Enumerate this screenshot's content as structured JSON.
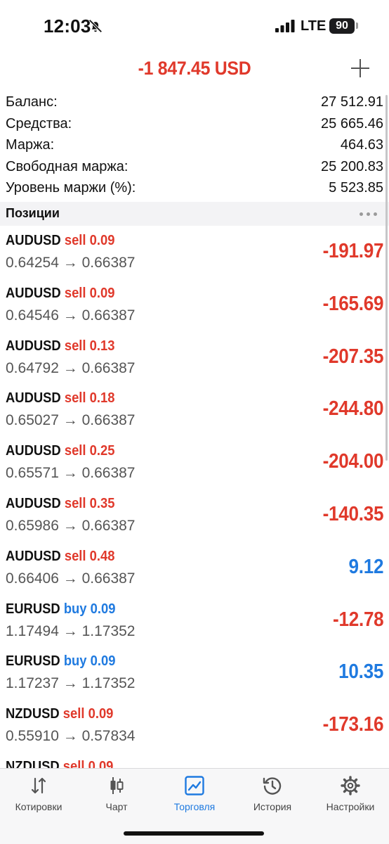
{
  "status_bar": {
    "time": "12:03",
    "network": "LTE",
    "battery": "90",
    "icons": [
      "bell-off-icon",
      "signal-icon",
      "battery-icon"
    ]
  },
  "header": {
    "total": "-1 847.45 USD",
    "add_icon": "plus-icon"
  },
  "summary": [
    {
      "label": "Баланс:",
      "value": "27 512.91"
    },
    {
      "label": "Средства:",
      "value": "25 665.46"
    },
    {
      "label": "Маржа:",
      "value": "464.63"
    },
    {
      "label": "Свободная маржа:",
      "value": "25 200.83"
    },
    {
      "label": "Уровень маржи (%):",
      "value": "5 523.85"
    }
  ],
  "section": {
    "title": "Позиции",
    "more_icon": "more-dots-icon"
  },
  "positions": [
    {
      "symbol": "AUDUSD",
      "type": "sell",
      "volume": "0.09",
      "prices": "0.64254 → 0.66387",
      "profit": "-191.97"
    },
    {
      "symbol": "AUDUSD",
      "type": "sell",
      "volume": "0.09",
      "prices": "0.64546 → 0.66387",
      "profit": "-165.69"
    },
    {
      "symbol": "AUDUSD",
      "type": "sell",
      "volume": "0.13",
      "prices": "0.64792 → 0.66387",
      "profit": "-207.35"
    },
    {
      "symbol": "AUDUSD",
      "type": "sell",
      "volume": "0.18",
      "prices": "0.65027 → 0.66387",
      "profit": "-244.80"
    },
    {
      "symbol": "AUDUSD",
      "type": "sell",
      "volume": "0.25",
      "prices": "0.65571 → 0.66387",
      "profit": "-204.00"
    },
    {
      "symbol": "AUDUSD",
      "type": "sell",
      "volume": "0.35",
      "prices": "0.65986 → 0.66387",
      "profit": "-140.35"
    },
    {
      "symbol": "AUDUSD",
      "type": "sell",
      "volume": "0.48",
      "prices": "0.66406 → 0.66387",
      "profit": "9.12"
    },
    {
      "symbol": "EURUSD",
      "type": "buy",
      "volume": "0.09",
      "prices": "1.17494 → 1.17352",
      "profit": "-12.78"
    },
    {
      "symbol": "EURUSD",
      "type": "buy",
      "volume": "0.09",
      "prices": "1.17237 → 1.17352",
      "profit": "10.35"
    },
    {
      "symbol": "NZDUSD",
      "type": "sell",
      "volume": "0.09",
      "prices": "0.55910 → 0.57834",
      "profit": "-173.16"
    },
    {
      "symbol": "NZDUSD",
      "type": "sell",
      "volume": "0.09",
      "prices": "",
      "profit": ""
    }
  ],
  "tabs": [
    {
      "label": "Котировки",
      "icon": "quotes-icon",
      "active": false
    },
    {
      "label": "Чарт",
      "icon": "chart-icon",
      "active": false
    },
    {
      "label": "Торговля",
      "icon": "trade-icon",
      "active": true
    },
    {
      "label": "История",
      "icon": "history-icon",
      "active": false
    },
    {
      "label": "Настройки",
      "icon": "settings-icon",
      "active": false
    }
  ],
  "colors": {
    "negative": "#e0392b",
    "positive": "#1f7ae0",
    "active_tab": "#1f7ae0"
  }
}
